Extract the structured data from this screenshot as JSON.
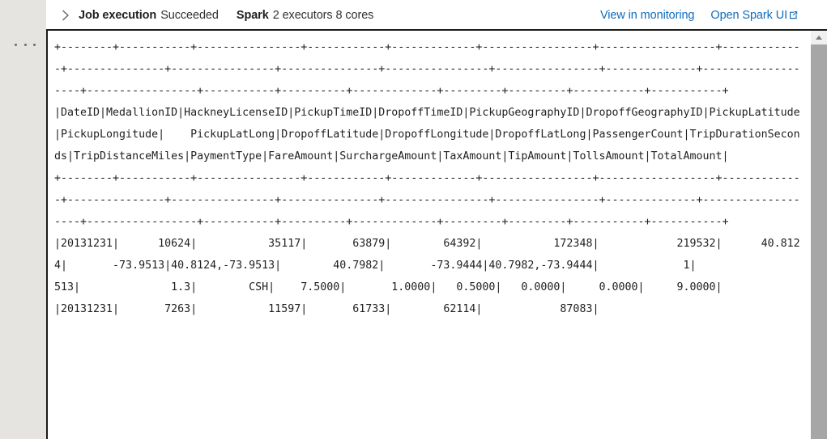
{
  "gutter": {
    "menu_icon": "ellipsis-icon"
  },
  "header": {
    "expand_icon": "chevron-right-icon",
    "job_label": "Job execution",
    "job_status": "Succeeded",
    "engine_label": "Spark",
    "engine_detail": "2 executors 8 cores",
    "link_monitoring": "View in monitoring",
    "link_spark_ui": "Open Spark UI",
    "external_link_icon": "external-link-icon",
    "link_color": "#0f6cbd"
  },
  "scrollbar": {
    "up_icon": "scroll-up-arrow-icon",
    "thumb_color": "#a6a6a6"
  },
  "output": {
    "text": "+--------+-----------+----------------+------------+-------------+-----------------+------------------+-------------+---------------+----------------+---------------+----------------+----------------+--------------+-------------------+-----------------+-----------+----------+-------------+---------+---------+-----------+-----------+\n|DateID|MedallionID|HackneyLicenseID|PickupTimeID|DropoffTimeID|PickupGeographyID|DropoffGeographyID|PickupLatitude|PickupLongitude|    PickupLatLong|DropoffLatitude|DropoffLongitude|DropoffLatLong|PassengerCount|TripDurationSeconds|TripDistanceMiles|PaymentType|FareAmount|SurchargeAmount|TaxAmount|TipAmount|TollsAmount|TotalAmount|\n+--------+-----------+----------------+------------+-------------+-----------------+------------------+-------------+---------------+----------------+---------------+----------------+----------------+--------------+-------------------+-----------------+-----------+----------+-------------+---------+---------+-----------+-----------+\n|20131231|      10624|           35117|       63879|        64392|           172348|            219532|      40.8124|       -73.9513|40.8124,-73.9513|        40.7982|       -73.9444|40.7982,-73.9444|             1|                513|              1.3|        CSH|    7.5000|       1.0000|   0.5000|   0.0000|     0.0000|     9.0000|\n|20131231|       7263|           11597|       61733|        62114|            87083|"
  }
}
